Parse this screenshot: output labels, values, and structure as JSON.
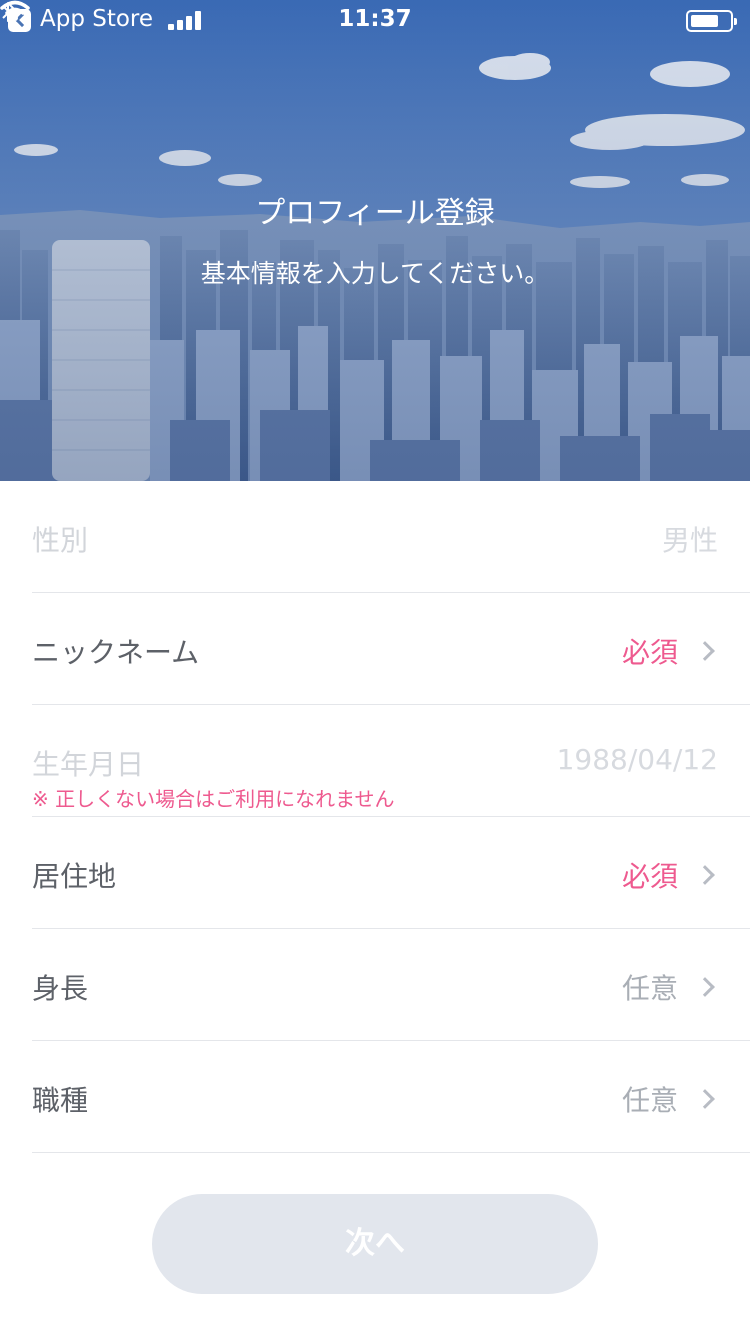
{
  "status_bar": {
    "back_app": "App Store",
    "time": "11:37",
    "icons": [
      "back-icon",
      "signal-icon",
      "wifi-icon",
      "bluetooth-icon",
      "battery-icon"
    ]
  },
  "header": {
    "title": "プロフィール登録",
    "subtitle": "基本情報を入力してください。"
  },
  "form": {
    "rows": [
      {
        "label": "性別",
        "value": "男性"
      },
      {
        "label": "ニックネーム",
        "value": "必須"
      },
      {
        "label": "生年月日",
        "value": "1988/04/12",
        "note": "※ 正しくない場合はご利用になれません"
      },
      {
        "label": "居住地",
        "value": "必須"
      },
      {
        "label": "身長",
        "value": "任意"
      },
      {
        "label": "職種",
        "value": "任意"
      }
    ]
  },
  "footer": {
    "next_label": "次へ"
  },
  "colors": {
    "required": "#ee5a8f",
    "optional": "#a9aeb5",
    "button_disabled": "#e2e6ed",
    "sky": "#3f73c2"
  }
}
